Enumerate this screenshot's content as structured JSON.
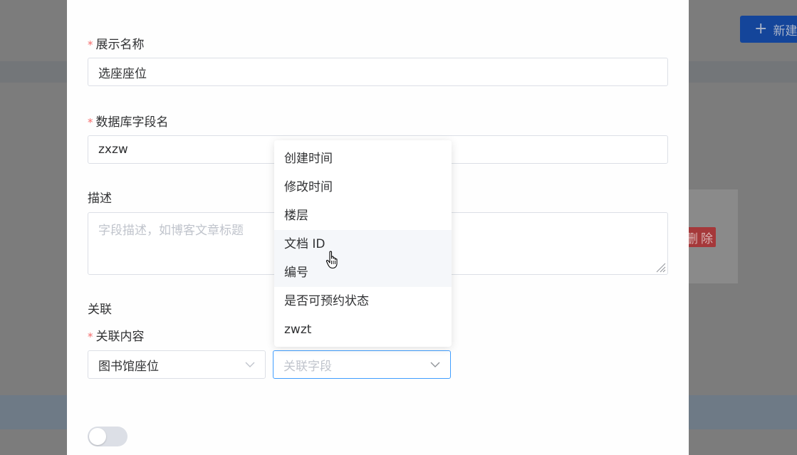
{
  "background": {
    "new_button_label": "新建",
    "delete_button_label": "删除"
  },
  "form": {
    "display_name": {
      "label": "展示名称",
      "value": "选座座位",
      "required": true
    },
    "db_field_name": {
      "label": "数据库字段名",
      "value": "zxzw",
      "required": true
    },
    "description": {
      "label": "描述",
      "placeholder": "字段描述，如博客文章标题"
    },
    "relation_section_label": "关联",
    "relation_content": {
      "label": "关联内容",
      "required": true,
      "selected_collection": "图书馆座位",
      "field_placeholder": "关联字段"
    },
    "toggle_on": false
  },
  "dropdown": {
    "options": [
      "创建时间",
      "修改时间",
      "楼层",
      "文档 ID",
      "编号",
      "是否可预约状态",
      "zwzt"
    ],
    "hovered_index": 3
  },
  "colors": {
    "required": "#f56c6c",
    "focus": "#409eff",
    "primary": "#14459a",
    "danger": "#a5383a"
  }
}
